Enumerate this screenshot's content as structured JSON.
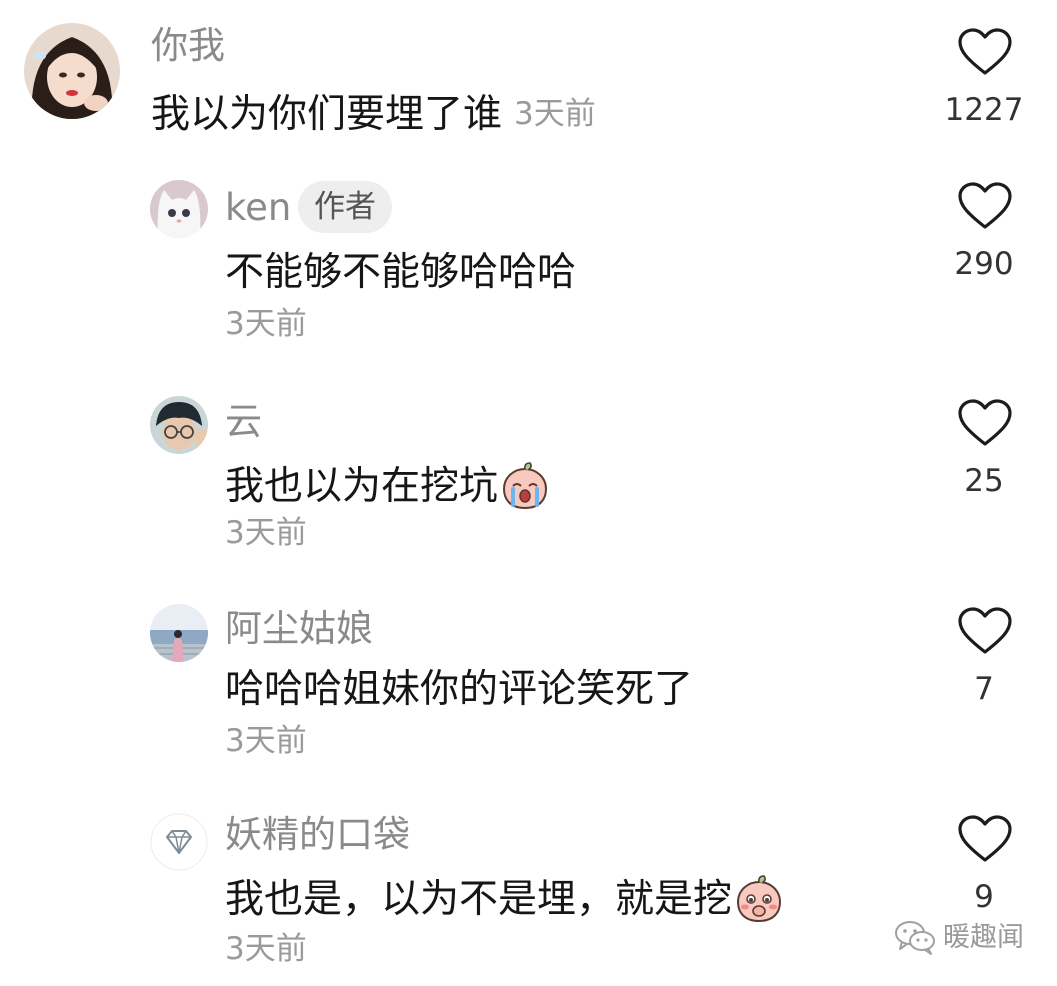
{
  "comments": [
    {
      "username": "你我",
      "text": "我以为你们要埋了谁",
      "time": "3天前",
      "likes": "1227",
      "avatar_icon": "girl-avatar"
    },
    {
      "username": "ken",
      "badge": "作者",
      "text": "不能够不能够哈哈哈",
      "time": "3天前",
      "likes": "290",
      "avatar_icon": "white-cat-avatar"
    },
    {
      "username": "云",
      "text": "我也以为在挖坑",
      "time": "3天前",
      "likes": "25",
      "avatar_icon": "boy-glasses-avatar",
      "emoji": "crying-peach-emoji"
    },
    {
      "username": "阿尘姑娘",
      "text": "哈哈哈姐妹你的评论笑死了",
      "time": "3天前",
      "likes": "7",
      "avatar_icon": "girl-seaside-avatar"
    },
    {
      "username": "妖精的口袋",
      "text": "我也是，以为不是埋，就是挖",
      "time": "3天前",
      "likes": "9",
      "avatar_icon": "diamond-avatar",
      "emoji": "blushing-peach-emoji"
    }
  ],
  "watermark": {
    "text": "暖趣闻",
    "icon": "wechat-icon"
  },
  "colors": {
    "username": "#8a8a8a",
    "text": "#161616",
    "time": "#9a9a9a",
    "like_count": "#333333",
    "badge_bg": "#eeeeee"
  }
}
